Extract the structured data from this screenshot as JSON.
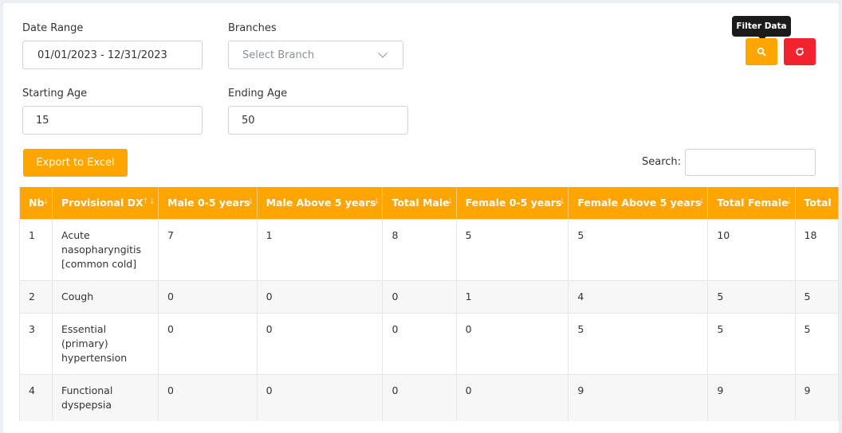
{
  "filters": {
    "date_range_label": "Date Range",
    "date_range_value": "01/01/2023 - 12/31/2023",
    "branches_label": "Branches",
    "branches_placeholder": "Select Branch",
    "starting_age_label": "Starting Age",
    "starting_age_value": "15",
    "ending_age_label": "Ending Age",
    "ending_age_value": "50"
  },
  "actions": {
    "filter_tooltip": "Filter Data",
    "filter_icon": "search-icon",
    "reset_icon": "refresh-icon",
    "export_label": "Export to Excel",
    "search_label": "Search:"
  },
  "colors": {
    "accent": "#ffa500",
    "danger": "#f0232f"
  },
  "table": {
    "headers": [
      "Nb",
      "Provisional DX",
      "Male 0-5 years",
      "Male Above 5 years",
      "Total Male",
      "Female 0-5 years",
      "Female Above 5 years",
      "Total Female",
      "Total"
    ],
    "rows": [
      [
        "1",
        "Acute nasopharyngitis [common cold]",
        "7",
        "1",
        "8",
        "5",
        "5",
        "10",
        "18"
      ],
      [
        "2",
        "Cough",
        "0",
        "0",
        "0",
        "1",
        "4",
        "5",
        "5"
      ],
      [
        "3",
        "Essential (primary) hypertension",
        "0",
        "0",
        "0",
        "0",
        "5",
        "5",
        "5"
      ],
      [
        "4",
        "Functional dyspepsia",
        "0",
        "0",
        "0",
        "0",
        "9",
        "9",
        "9"
      ]
    ]
  }
}
